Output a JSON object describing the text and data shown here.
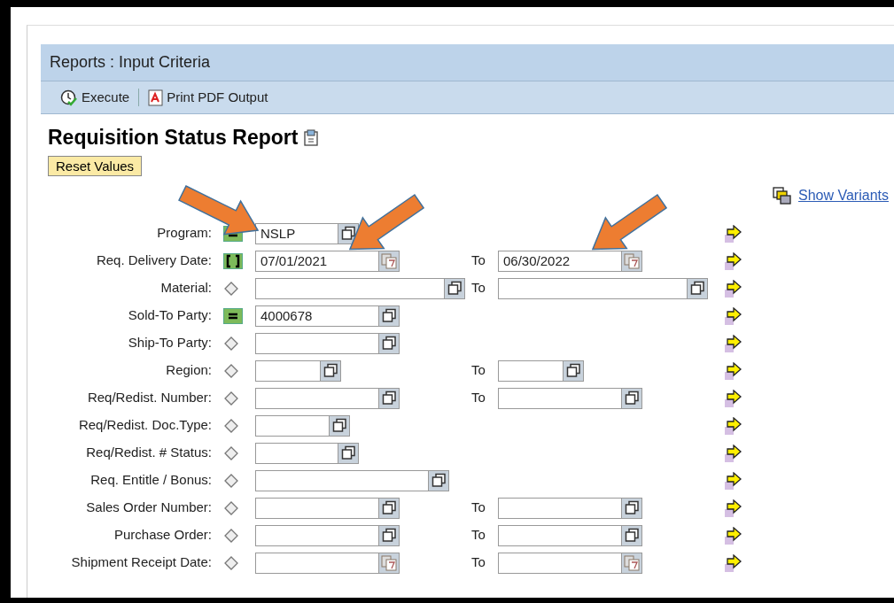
{
  "header": {
    "title": "Reports : Input Criteria"
  },
  "toolbar": [
    {
      "kind": "execute",
      "label": "Execute"
    },
    {
      "kind": "pdf",
      "label": "Print PDF Output"
    }
  ],
  "report_title": "Requisition Status Report",
  "reset_button": "Reset Values",
  "variants_link": "Show Variants",
  "criteria": [
    {
      "label": "Program:",
      "kind": "equals",
      "low": {
        "value": "NSLP",
        "kind": "value-help",
        "callout": true
      }
    },
    {
      "label": "Req. Delivery Date:",
      "kind": "between",
      "low": {
        "value": "07/01/2021",
        "kind": "calendar",
        "callout": true
      },
      "to_label": "To",
      "high": {
        "value": "06/30/2022",
        "kind": "calendar",
        "callout": true
      }
    },
    {
      "label": "Material:",
      "kind": "open",
      "low": {
        "kind": "value-help"
      },
      "to_label": "To",
      "high": {
        "kind": "value-help"
      }
    },
    {
      "label": "Sold-To Party:",
      "kind": "equals",
      "low": {
        "value": "4000678",
        "kind": "value-help"
      }
    },
    {
      "label": "Ship-To Party:",
      "kind": "open",
      "low": {
        "kind": "value-help"
      }
    },
    {
      "label": "Region:",
      "kind": "open",
      "low": {
        "kind": "value-help"
      },
      "to_label": "To",
      "high": {
        "kind": "value-help"
      }
    },
    {
      "label": "Req/Redist. Number:",
      "kind": "open",
      "low": {
        "kind": "value-help"
      },
      "to_label": "To",
      "high": {
        "kind": "value-help"
      }
    },
    {
      "label": "Req/Redist. Doc.Type:",
      "kind": "open",
      "low": {
        "kind": "value-help"
      }
    },
    {
      "label": "Req/Redist. # Status:",
      "kind": "open",
      "low": {
        "kind": "value-help"
      }
    },
    {
      "label": "Req. Entitle / Bonus:",
      "kind": "open",
      "low": {
        "kind": "value-help"
      }
    },
    {
      "label": "Sales Order Number:",
      "kind": "open",
      "low": {
        "kind": "value-help"
      },
      "to_label": "To",
      "high": {
        "kind": "value-help"
      }
    },
    {
      "label": "Purchase Order:",
      "kind": "open",
      "low": {
        "kind": "value-help"
      },
      "to_label": "To",
      "high": {
        "kind": "value-help"
      }
    },
    {
      "label": "Shipment Receipt Date:",
      "kind": "open",
      "low": {
        "kind": "calendar"
      },
      "to_label": "To",
      "high": {
        "kind": "calendar"
      }
    }
  ]
}
